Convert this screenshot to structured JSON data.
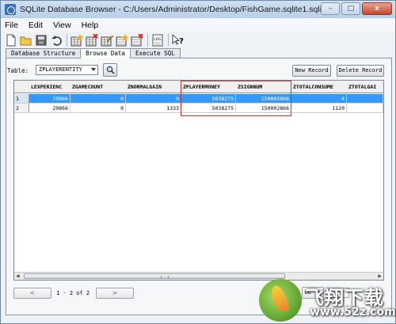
{
  "window": {
    "title": "SQLite Database Browser - C:/Users/Administrator/Desktop/FishGame.sqlite1.sqlite",
    "minimize": "–",
    "maximize": "□",
    "close": "x"
  },
  "menu": [
    "File",
    "Edit",
    "View",
    "Help"
  ],
  "toolbar": {
    "icons": [
      "new-db-icon",
      "open-db-icon",
      "save-icon",
      "undo-icon",
      "create-table-icon",
      "delete-table-icon",
      "modify-table-icon",
      "create-index-icon",
      "delete-index-icon",
      "log-icon",
      "whats-this-icon"
    ],
    "log_label": "LOG",
    "help_label": "?"
  },
  "tabs": [
    {
      "label": "Database Structure",
      "active": false
    },
    {
      "label": "Browse Data",
      "active": true
    },
    {
      "label": "Execute SQL",
      "active": false
    }
  ],
  "browse": {
    "table_label": "Table:",
    "table_selected": "ZPLAYERENTITY",
    "new_record": "New Record",
    "delete_record": "Delete Record"
  },
  "grid": {
    "columns": [
      "LEXPERIENC",
      "ZGAMECOUNT",
      "ZNORMALGAIN",
      "ZPLAYERMONEY",
      "ZSIGNNUM",
      "ZTOTALCONSUME",
      "ZTOTALGAI"
    ],
    "rows": [
      {
        "num": "1",
        "selected": true,
        "cells": [
          "29866",
          "0",
          "0",
          "5038275",
          "150002866",
          "4",
          ""
        ]
      },
      {
        "num": "2",
        "selected": false,
        "cells": [
          "29866",
          "0",
          "1333",
          "5038275",
          "150002866",
          "1120",
          ""
        ]
      }
    ]
  },
  "pager": {
    "prev": "<",
    "info": "1 - 2 of 2",
    "next": ">",
    "goto": "Go to"
  },
  "watermark": {
    "brand": "飞翔下载",
    "url": "www.52z.com"
  }
}
